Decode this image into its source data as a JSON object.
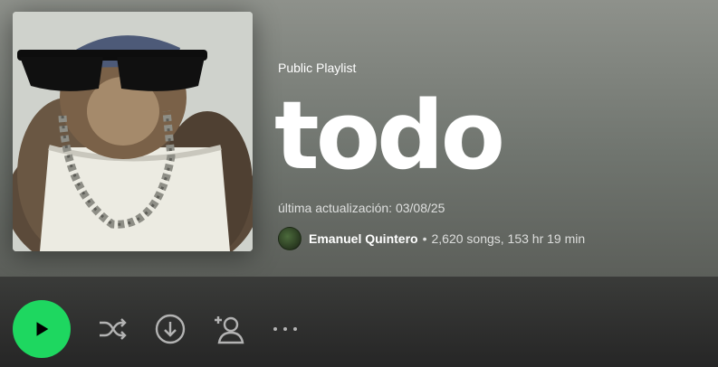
{
  "playlist": {
    "type_label": "Public Playlist",
    "title": "todo",
    "updated": "última actualización: 03/08/25",
    "owner": "Emanuel Quintero",
    "separator": "•",
    "stats": "2,620 songs, 153 hr 19 min"
  },
  "icons": {
    "play": "play-icon",
    "shuffle": "shuffle-icon",
    "download": "download-icon",
    "add_user": "add-user-icon",
    "more": "more-options-icon"
  },
  "colors": {
    "accent": "#1ed760",
    "hero_top": "#8e918b",
    "background": "#252525"
  }
}
